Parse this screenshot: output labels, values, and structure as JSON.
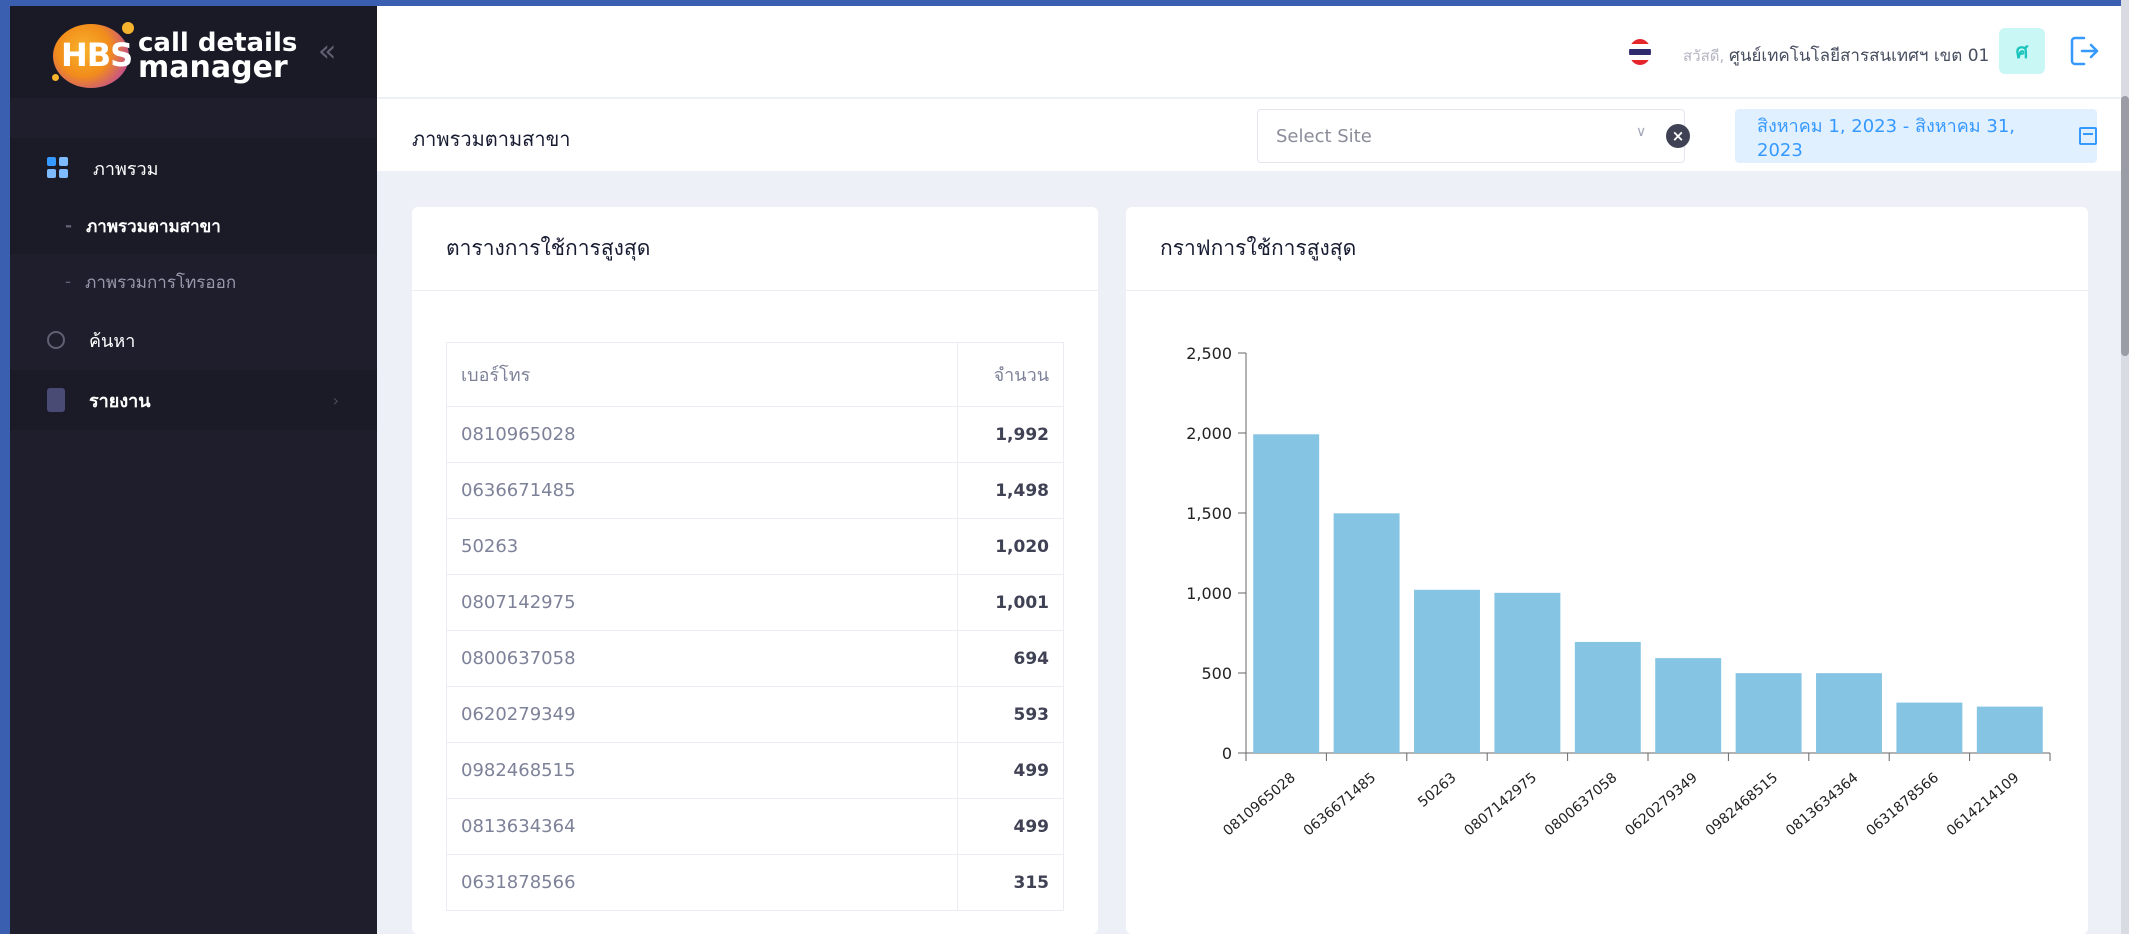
{
  "brand": {
    "logo_mark": "HBS",
    "name_line1": "call details",
    "name_line2": "manager"
  },
  "sidebar": {
    "items": [
      {
        "label": "ภาพรวม",
        "icon": "grid-icon"
      },
      {
        "label": "ภาพรวมตามสาขา",
        "sub": true,
        "active": true
      },
      {
        "label": "ภาพรวมการโทรออก",
        "sub": true
      },
      {
        "label": "ค้นหา",
        "icon": "circle-icon"
      },
      {
        "label": "รายงาน",
        "icon": "clipboard-icon",
        "has_arrow": true
      }
    ]
  },
  "header": {
    "greeting": "สวัสดี,",
    "user_name": "ศูนย์เทคโนโลยีสารสนเทศฯ เขต 01",
    "avatar_letter": "ศ"
  },
  "subheader": {
    "title": "ภาพรวมตามสาขา",
    "site_placeholder": "Select Site",
    "date_range": "สิงหาคม 1, 2023 - สิงหาคม 31, 2023"
  },
  "table_card": {
    "title": "ตารางการใช้การสูงสุด",
    "col_number": "เบอร์โทร",
    "col_count": "จำนวน",
    "rows": [
      {
        "number": "0810965028",
        "count": "1,992"
      },
      {
        "number": "0636671485",
        "count": "1,498"
      },
      {
        "number": "50263",
        "count": "1,020"
      },
      {
        "number": "0807142975",
        "count": "1,001"
      },
      {
        "number": "0800637058",
        "count": "694"
      },
      {
        "number": "0620279349",
        "count": "593"
      },
      {
        "number": "0982468515",
        "count": "499"
      },
      {
        "number": "0813634364",
        "count": "499"
      },
      {
        "number": "0631878566",
        "count": "315"
      }
    ]
  },
  "chart_card": {
    "title": "กราฟการใช้การสูงสุด"
  },
  "chart_data": {
    "type": "bar",
    "categories": [
      "0810965028",
      "0636671485",
      "50263",
      "0807142975",
      "0800637058",
      "0620279349",
      "0982468515",
      "0813634364",
      "0631878566",
      "0614214109"
    ],
    "values": [
      1992,
      1498,
      1020,
      1001,
      694,
      593,
      499,
      499,
      315,
      290
    ],
    "ylim": [
      0,
      2500
    ],
    "yticks": [
      "0",
      "500",
      "1,000",
      "1,500",
      "2,000",
      "2,500"
    ],
    "bar_color": "#86c4e4",
    "grid": false
  },
  "colors": {
    "primary": "#3699ff",
    "sidebar_bg": "#1e1e2d",
    "avatar_bg": "#c9f7f5",
    "avatar_fg": "#1bc5bd"
  }
}
